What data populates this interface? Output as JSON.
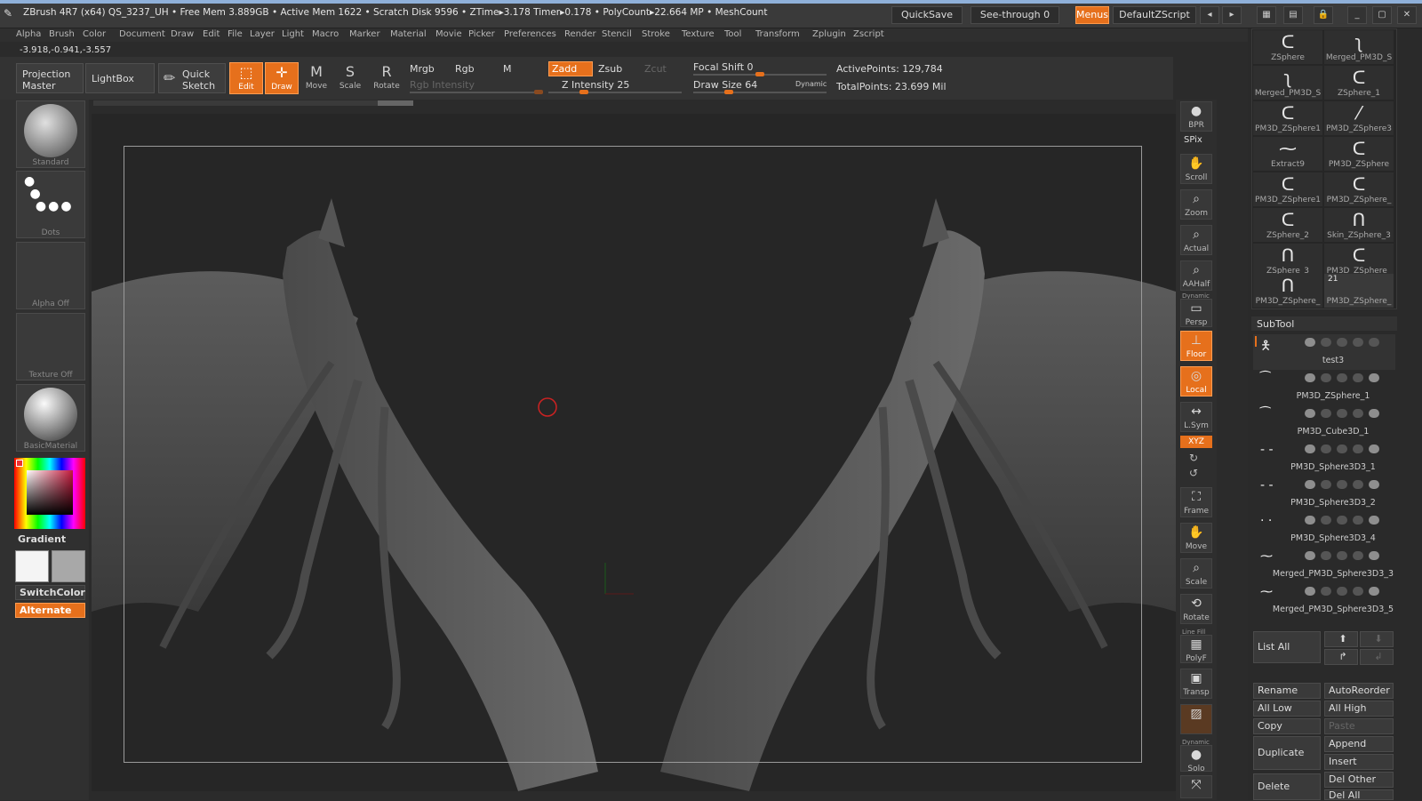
{
  "titlebar": {
    "text": "ZBrush 4R7 (x64)   QS_3237_UH    • Free Mem 3.889GB • Active Mem 1622 • Scratch Disk 9596 •  ZTime▸3.178 Timer▸0.178 • PolyCount▸22.664 MP  • MeshCount",
    "quicksave": "QuickSave",
    "see_through": "See-through  0",
    "menus": "Menus",
    "script": "DefaultZScript"
  },
  "menubar": [
    "Alpha",
    "Brush",
    "Color",
    "Document",
    "Draw",
    "Edit",
    "File",
    "Layer",
    "Light",
    "Macro",
    "Marker",
    "Material",
    "Movie",
    "Picker",
    "Preferences",
    "Render",
    "Stencil",
    "Stroke",
    "Texture",
    "Tool",
    "Transform",
    "Zplugin",
    "Zscript"
  ],
  "coords": "-3.918,-0.941,-3.557",
  "toolbar": {
    "projection_master": "Projection Master",
    "lightbox": "LightBox",
    "quick_sketch": "Quick Sketch",
    "edit": "Edit",
    "draw": "Draw",
    "move": "Move",
    "scale": "Scale",
    "rotate": "Rotate",
    "mrgb": "Mrgb",
    "rgb": "Rgb",
    "m": "M",
    "rgb_intensity": "Rgb  Intensity",
    "zadd": "Zadd",
    "zsub": "Zsub",
    "zcut": "Zcut",
    "z_intensity": "Z Intensity 25",
    "z_intensity_value": 0.25,
    "focal_shift": "Focal Shift 0",
    "focal_shift_value": 0.5,
    "draw_size": "Draw Size 64",
    "draw_size_value": 0.25,
    "dynamic": "Dynamic",
    "active_points": "ActivePoints: 129,784",
    "total_points": "TotalPoints: 23.699 Mil"
  },
  "leftbar": {
    "brush": "Standard",
    "stroke": "Dots",
    "alpha": "Alpha Off",
    "texture": "Texture Off",
    "material": "BasicMaterial",
    "gradient": "Gradient",
    "switchcolor": "SwitchColor",
    "alternate": "Alternate"
  },
  "shelf": [
    "BPR",
    "SPix",
    "Scroll",
    "Zoom",
    "Actual",
    "AAHalf",
    "Persp",
    "Floor",
    "Local",
    "L.Sym",
    "XYZ",
    "Frame",
    "Move",
    "Scale",
    "Rotate",
    "PolyF",
    "Transp",
    "Solo"
  ],
  "shelf_sub": {
    "dynamic": "Dynamic",
    "linefill": "Line Fill"
  },
  "tools": [
    {
      "name": "ZSphere"
    },
    {
      "name": "Merged_PM3D_S"
    },
    {
      "name": "Merged_PM3D_S"
    },
    {
      "name": "ZSphere_1"
    },
    {
      "name": "PM3D_ZSphere1"
    },
    {
      "name": "PM3D_ZSphere3"
    },
    {
      "name": "Extract9"
    },
    {
      "name": "PM3D_ZSphere"
    },
    {
      "name": "PM3D_ZSphere1"
    },
    {
      "name": "PM3D_ZSphere_"
    },
    {
      "name": "ZSphere_2"
    },
    {
      "name": "Skin_ZSphere_3"
    },
    {
      "name": "ZSphere_3"
    },
    {
      "name": "PM3D_ZSphere_"
    },
    {
      "name": "PM3D_ZSphere_"
    },
    {
      "name": "PM3D_ZSphere_"
    }
  ],
  "tool_count": "21",
  "subtool": {
    "title": "SubTool",
    "items": [
      "test3",
      "PM3D_ZSphere_1",
      "PM3D_Cube3D_1",
      "PM3D_Sphere3D3_1",
      "PM3D_Sphere3D3_2",
      "PM3D_Sphere3D3_4",
      "Merged_PM3D_Sphere3D3_3",
      "Merged_PM3D_Sphere3D3_5"
    ],
    "list_all": "List  All",
    "rename": "Rename",
    "autoreorder": "AutoReorder",
    "all_low": "All Low",
    "all_high": "All High",
    "copy": "Copy",
    "paste": "Paste",
    "duplicate": "Duplicate",
    "append": "Append",
    "insert": "Insert",
    "delete": "Delete",
    "del_other": "Del Other",
    "del_all": "Del All"
  },
  "colors": {
    "accent": "#e6701c",
    "bg": "#2b2b2b"
  }
}
